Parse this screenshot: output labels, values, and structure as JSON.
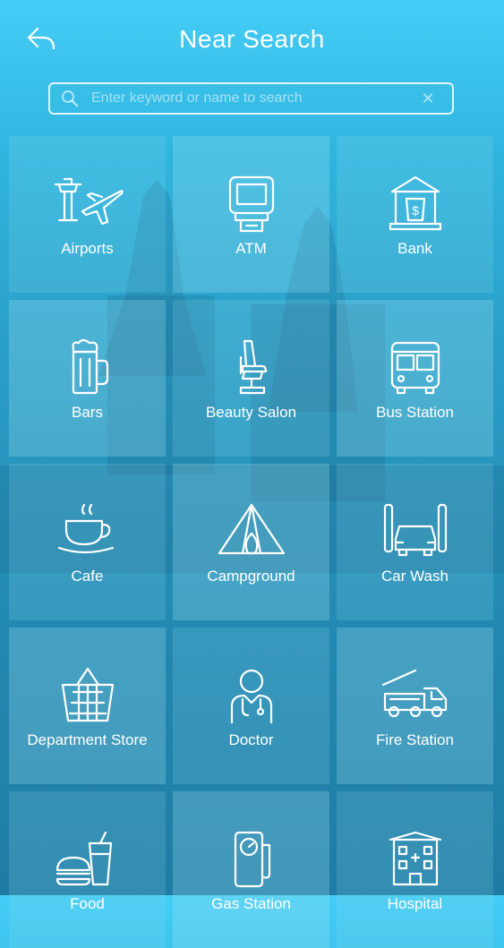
{
  "header": {
    "title": "Near Search"
  },
  "search": {
    "placeholder": "Enter keyword or name to search",
    "value": ""
  },
  "categories": [
    {
      "label": "Airports",
      "icon": "airport-icon"
    },
    {
      "label": "ATM",
      "icon": "atm-icon"
    },
    {
      "label": "Bank",
      "icon": "bank-icon"
    },
    {
      "label": "Bars",
      "icon": "beer-mug-icon"
    },
    {
      "label": "Beauty Salon",
      "icon": "salon-chair-icon"
    },
    {
      "label": "Bus Station",
      "icon": "bus-icon"
    },
    {
      "label": "Cafe",
      "icon": "coffee-cup-icon"
    },
    {
      "label": "Campground",
      "icon": "tent-icon"
    },
    {
      "label": "Car Wash",
      "icon": "car-wash-icon"
    },
    {
      "label": "Department Store",
      "icon": "basket-icon"
    },
    {
      "label": "Doctor",
      "icon": "doctor-icon"
    },
    {
      "label": "Fire Station",
      "icon": "fire-truck-icon"
    },
    {
      "label": "Food",
      "icon": "burger-drink-icon"
    },
    {
      "label": "Gas Station",
      "icon": "gas-pump-icon"
    },
    {
      "label": "Hospital",
      "icon": "hospital-icon"
    }
  ]
}
